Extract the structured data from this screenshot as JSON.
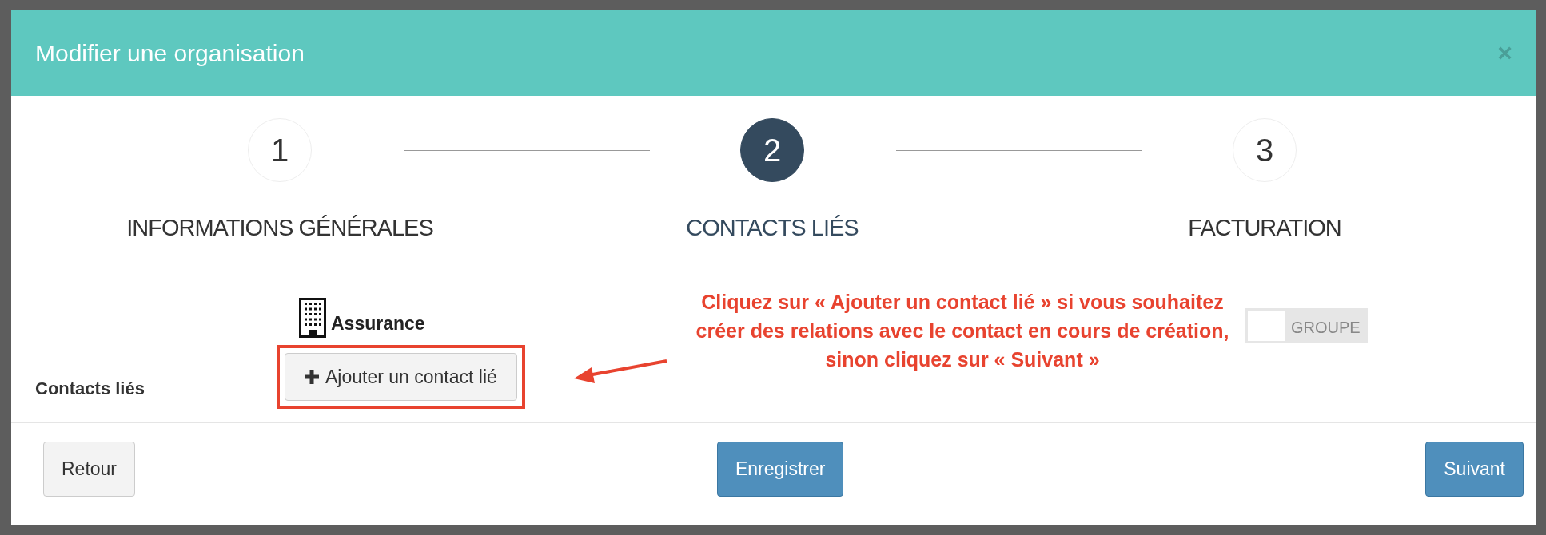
{
  "dialog": {
    "title": "Modifier une organisation",
    "close": "×"
  },
  "steps": [
    {
      "number": "1",
      "label": "INFORMATIONS GÉNÉRALES",
      "selected": false
    },
    {
      "number": "2",
      "label": "CONTACTS LIÉS",
      "selected": true
    },
    {
      "number": "3",
      "label": "FACTURATION",
      "selected": false
    }
  ],
  "organisation": {
    "name": "Assurance"
  },
  "contacts": {
    "label": "Contacts liés",
    "add_button": "Ajouter un contact lié"
  },
  "annotation": {
    "lines": [
      "Cliquez sur « Ajouter un contact lié » si vous souhaitez",
      "créer des relations avec le contact en cours de création, sinon cliquez sur « Suivant »"
    ]
  },
  "toggle": {
    "label": "GROUPE",
    "on": false
  },
  "footer_buttons": [
    {
      "label": "Retour",
      "kind": "default"
    },
    {
      "label": "Enregistrer",
      "kind": "primary"
    },
    {
      "label": "Suivant",
      "kind": "primary"
    }
  ]
}
